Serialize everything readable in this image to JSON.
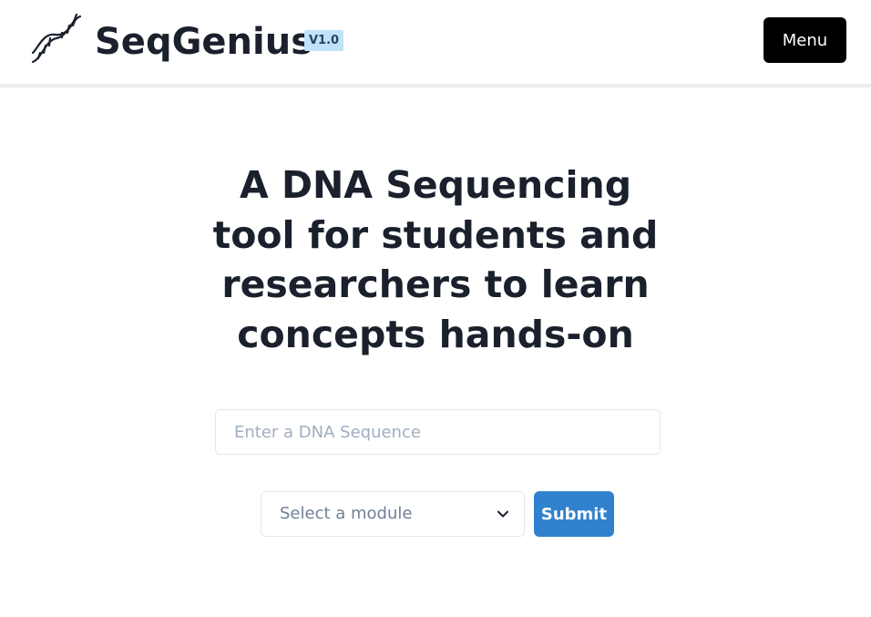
{
  "header": {
    "logo_icon": "dna-helix-icon",
    "brand": "SeqGenius",
    "version": "V1.0",
    "menu_label": "Menu"
  },
  "hero": {
    "headline": "A DNA Sequencing tool for students and researchers to learn concepts hands-on"
  },
  "form": {
    "sequence_placeholder": "Enter a DNA Sequence",
    "sequence_value": "",
    "module_selected": "Select a module",
    "submit_label": "Submit"
  },
  "colors": {
    "accent": "#3182ce",
    "badge_bg": "#bee3f8",
    "text": "#1a202c",
    "menu_bg": "#000000"
  }
}
